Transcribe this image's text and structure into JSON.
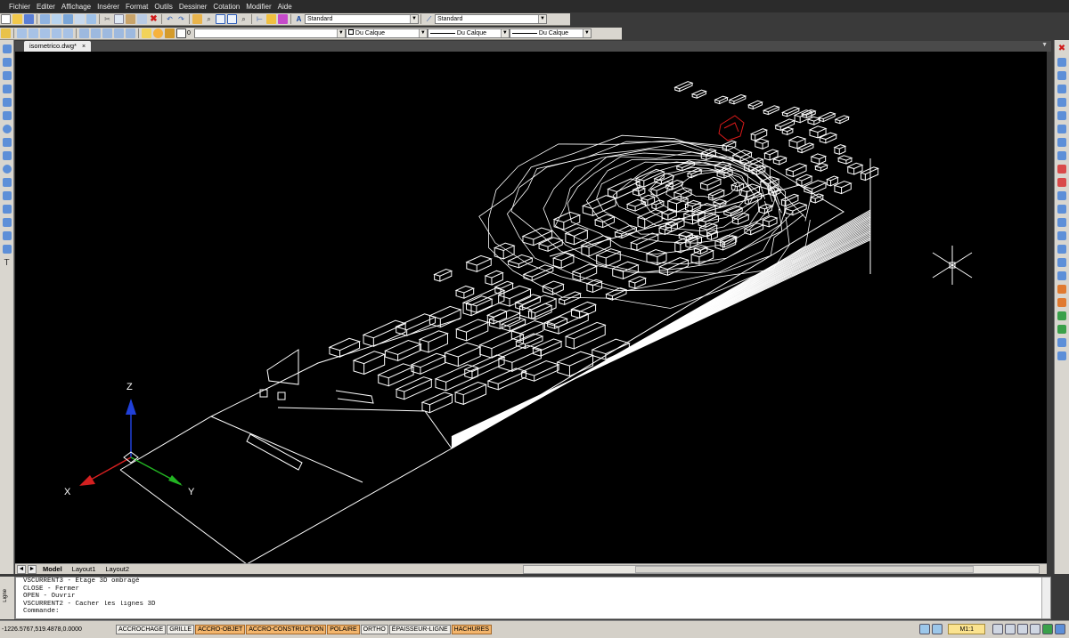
{
  "menu": [
    "Fichier",
    "Editer",
    "Affichage",
    "Insérer",
    "Format",
    "Outils",
    "Dessiner",
    "Cotation",
    "Modifier",
    "Aide"
  ],
  "toolbar1": {
    "text_style": "Standard",
    "dim_style": "Standard"
  },
  "toolbar2": {
    "layer": "0",
    "color": "Du Calque",
    "linetype": "Du Calque",
    "lineweight": "Du Calque"
  },
  "document_tab": {
    "label": "isometrico.dwg*",
    "close": "×"
  },
  "layout_tabs": [
    "Model",
    "Layout1",
    "Layout2"
  ],
  "ucs": {
    "x": "X",
    "y": "Y",
    "z": "Z"
  },
  "command_history": [
    "VSCURRENT3 - Étage 3D ombragé",
    "CLOSE - Fermer",
    "OPEN - Ouvrir",
    "VSCURRENT2 - Cacher les lignes 3D",
    "Commande:"
  ],
  "command_side_label": "Ligne",
  "status": {
    "coords": "-1226.5767,519.4878,0.0000",
    "buttons": [
      {
        "label": "ACCROCHAGE",
        "on": false
      },
      {
        "label": "GRILLE",
        "on": false
      },
      {
        "label": "ACCRO-OBJET",
        "on": true
      },
      {
        "label": "ACCRO-CONSTRUCTION",
        "on": true
      },
      {
        "label": "POLAIRE",
        "on": true
      },
      {
        "label": "ORTHO",
        "on": false
      },
      {
        "label": "ÉPAISSEUR-LIGNE",
        "on": false
      },
      {
        "label": "HACHURES",
        "on": true
      }
    ],
    "scale": "M1:1"
  },
  "colors": {
    "canvas": "#000000",
    "line": "#ffffff",
    "highlight": "#d91a1a",
    "axis_x": "#d42020",
    "axis_y": "#22b322",
    "axis_z": "#2040d8"
  }
}
